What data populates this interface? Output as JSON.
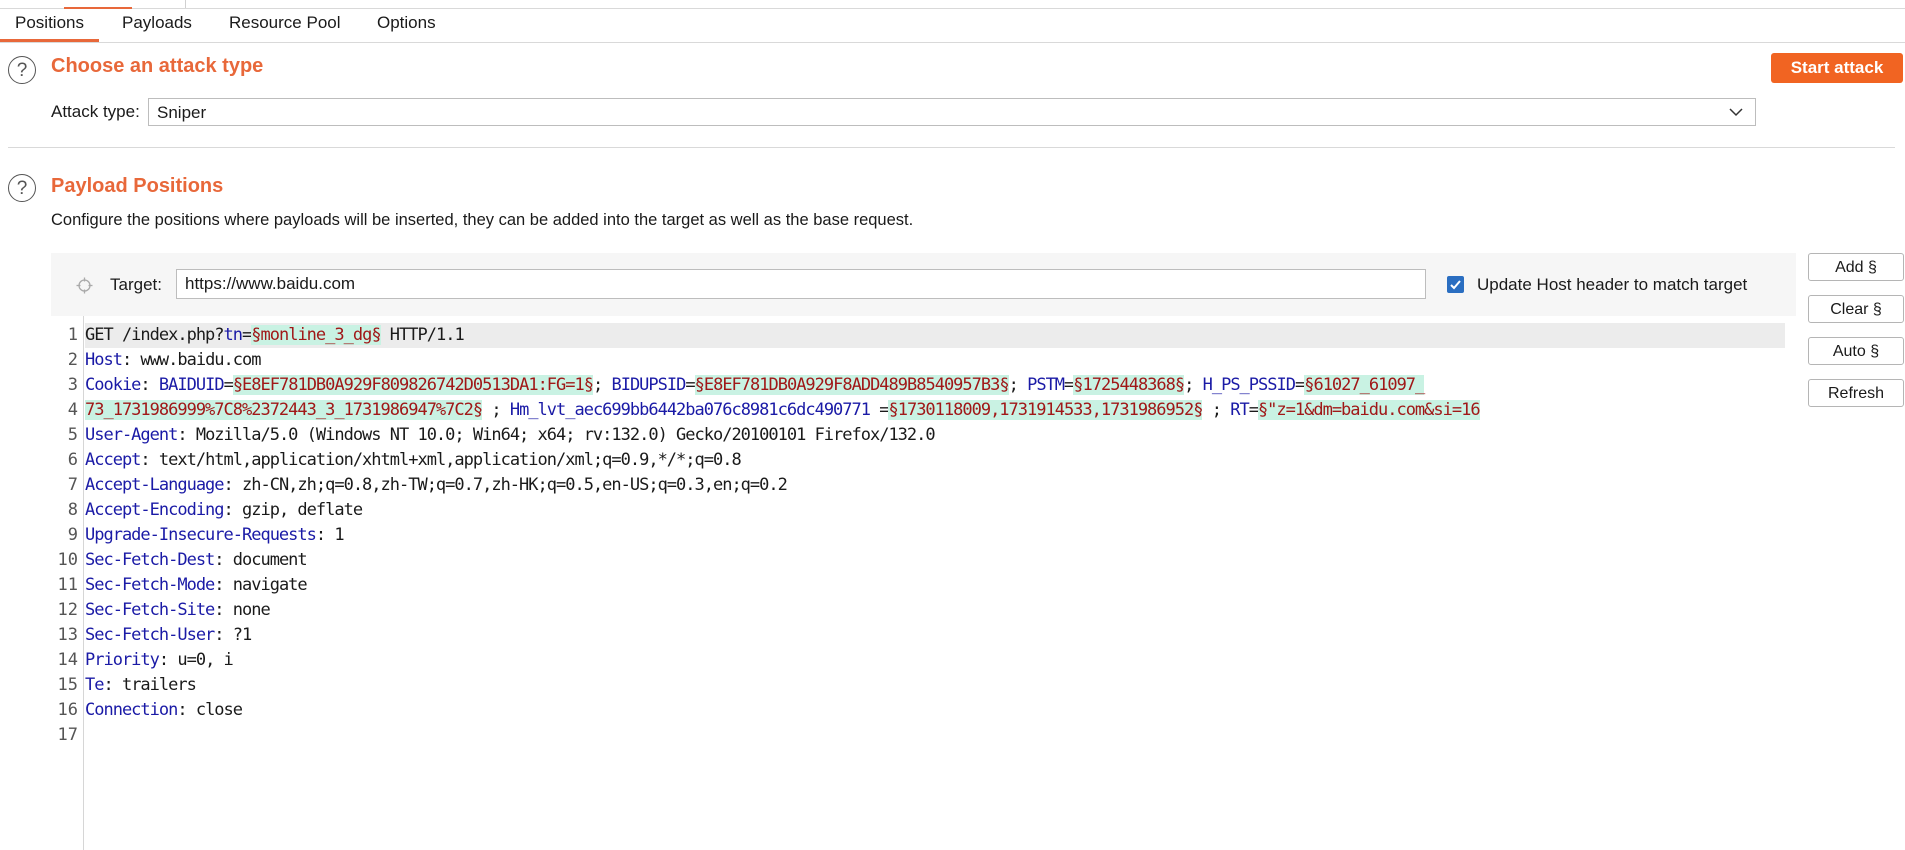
{
  "tabs": [
    {
      "label": "Positions",
      "active": true
    },
    {
      "label": "Payloads",
      "active": false
    },
    {
      "label": "Resource Pool",
      "active": false
    },
    {
      "label": "Options",
      "active": false
    }
  ],
  "attack_type": {
    "help_icon": "?",
    "title": "Choose an attack type",
    "label": "Attack type:",
    "selected": "Sniper",
    "start_button": "Start attack"
  },
  "payload_positions": {
    "help_icon": "?",
    "title": "Payload Positions",
    "description": "Configure the positions where payloads will be inserted, they can be added into the target as well as the base request.",
    "target_label": "Target:",
    "target_value": "https://www.baidu.com",
    "update_host_checked": true,
    "update_host_label": "Update Host header to match target"
  },
  "side_buttons": [
    "Add §",
    "Clear §",
    "Auto §",
    "Refresh"
  ],
  "line_numbers": [
    "1",
    "2",
    "3",
    "4",
    "5",
    "6",
    "7",
    "8",
    "9",
    "10",
    "11",
    "12",
    "13",
    "14",
    "15",
    "16",
    "17"
  ],
  "request_lines": [
    [
      {
        "t": "p",
        "s": "GET /index.php?"
      },
      {
        "t": "k",
        "s": "tn"
      },
      {
        "t": "p",
        "s": "="
      },
      {
        "t": "m",
        "s": "§monline_3_dg§"
      },
      {
        "t": "p",
        "s": " HTTP/1.1"
      }
    ],
    [
      {
        "t": "k",
        "s": "Host"
      },
      {
        "t": "p",
        "s": ": www.baidu.com"
      }
    ],
    [
      {
        "t": "k",
        "s": "Cookie"
      },
      {
        "t": "p",
        "s": ": "
      },
      {
        "t": "k",
        "s": "BAIDUID"
      },
      {
        "t": "p",
        "s": "="
      },
      {
        "t": "m",
        "s": "§E8EF781DB0A929F809826742D0513DA1:FG=1§"
      },
      {
        "t": "p",
        "s": "; "
      },
      {
        "t": "k",
        "s": "BIDUPSID"
      },
      {
        "t": "p",
        "s": "="
      },
      {
        "t": "m",
        "s": "§E8EF781DB0A929F8ADD489B8540957B3§"
      },
      {
        "t": "p",
        "s": "; "
      },
      {
        "t": "k",
        "s": "PSTM"
      },
      {
        "t": "p",
        "s": "="
      },
      {
        "t": "m",
        "s": "§1725448368§"
      },
      {
        "t": "p",
        "s": "; "
      },
      {
        "t": "k",
        "s": "H_PS_PSSID"
      },
      {
        "t": "p",
        "s": "="
      },
      {
        "t": "m",
        "s": "§61027_61097_"
      }
    ],
    [
      {
        "t": "m",
        "s": "73_1731986999%7C8%2372443_3_1731986947%7C2§"
      },
      {
        "t": "p",
        "s": " ; "
      },
      {
        "t": "k",
        "s": "Hm_lvt_aec699bb6442ba076c8981c6dc490771"
      },
      {
        "t": "p",
        "s": " ="
      },
      {
        "t": "m",
        "s": "§1730118009,1731914533,1731986952§"
      },
      {
        "t": "p",
        "s": " ; "
      },
      {
        "t": "k",
        "s": "RT"
      },
      {
        "t": "p",
        "s": "="
      },
      {
        "t": "m",
        "s": "§\"z=1&dm=baidu.com&si=16"
      }
    ],
    [
      {
        "t": "k",
        "s": "User-Agent"
      },
      {
        "t": "p",
        "s": ": Mozilla/5.0 (Windows NT 10.0; Win64; x64; rv:132.0) Gecko/20100101 Firefox/132.0"
      }
    ],
    [
      {
        "t": "k",
        "s": "Accept"
      },
      {
        "t": "p",
        "s": ": text/html,application/xhtml+xml,application/xml;q=0.9,*/*;q=0.8"
      }
    ],
    [
      {
        "t": "k",
        "s": "Accept-Language"
      },
      {
        "t": "p",
        "s": ": zh-CN,zh;q=0.8,zh-TW;q=0.7,zh-HK;q=0.5,en-US;q=0.3,en;q=0.2"
      }
    ],
    [
      {
        "t": "k",
        "s": "Accept-Encoding"
      },
      {
        "t": "p",
        "s": ": gzip, deflate"
      }
    ],
    [
      {
        "t": "k",
        "s": "Upgrade-Insecure-Requests"
      },
      {
        "t": "p",
        "s": ": 1"
      }
    ],
    [
      {
        "t": "k",
        "s": "Sec-Fetch-Dest"
      },
      {
        "t": "p",
        "s": ": document"
      }
    ],
    [
      {
        "t": "k",
        "s": "Sec-Fetch-Mode"
      },
      {
        "t": "p",
        "s": ": navigate"
      }
    ],
    [
      {
        "t": "k",
        "s": "Sec-Fetch-Site"
      },
      {
        "t": "p",
        "s": ": none"
      }
    ],
    [
      {
        "t": "k",
        "s": "Sec-Fetch-User"
      },
      {
        "t": "p",
        "s": ": ?1"
      }
    ],
    [
      {
        "t": "k",
        "s": "Priority"
      },
      {
        "t": "p",
        "s": ": u=0, i"
      }
    ],
    [
      {
        "t": "k",
        "s": "Te"
      },
      {
        "t": "p",
        "s": ": trailers"
      }
    ],
    [
      {
        "t": "k",
        "s": "Connection"
      },
      {
        "t": "p",
        "s": ": close"
      }
    ],
    [],
    []
  ],
  "colors": {
    "accent": "#e8683a",
    "start_button": "#f16422",
    "key": "#1a1aa6",
    "marker_text": "#a01818",
    "marker_bg": "#c9f2e3",
    "checkbox": "#2a6ec1"
  }
}
